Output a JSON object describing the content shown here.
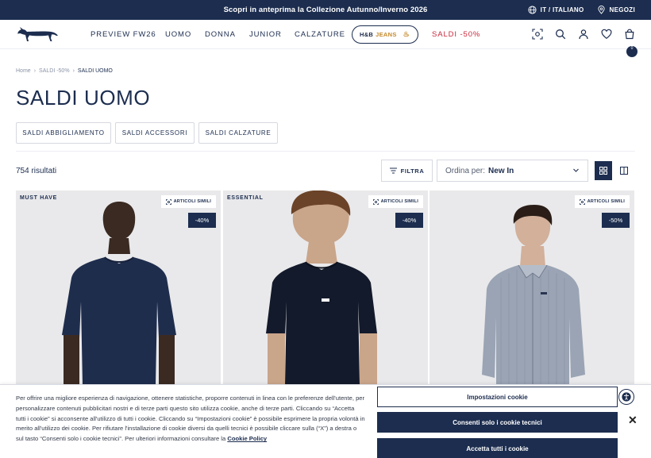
{
  "promo": {
    "text": "Scopri in anteprima la Collezione Autunno/Inverno 2026",
    "language": "IT / ITALIANO",
    "stores": "NEGOZI"
  },
  "header": {
    "nav": [
      "PREVIEW FW26",
      "UOMO",
      "DONNA",
      "JUNIOR",
      "CALZATURE"
    ],
    "jeans_hb": "H&B",
    "jeans_word": "JEANS",
    "sale": "SALDI -50%",
    "cart_count": "0"
  },
  "breadcrumb": [
    "Home",
    "SALDI -50%",
    "SALDI UOMO"
  ],
  "page_title": "SALDI UOMO",
  "categories": [
    "SALDI ABBIGLIAMENTO",
    "SALDI ACCESSORI",
    "SALDI CALZATURE"
  ],
  "toolbar": {
    "results": "754 risultati",
    "filter": "FILTRA",
    "sort_label": "Ordina per:",
    "sort_value": "New In"
  },
  "products": [
    {
      "tag": "MUST HAVE",
      "similar": "ARTICOLI SIMILI",
      "discount": "-40%",
      "garment_color": "#1f2d4d",
      "garment": "t-shirt"
    },
    {
      "tag": "ESSENTIAL",
      "similar": "ARTICOLI SIMILI",
      "discount": "-40%",
      "garment_color": "#131a2b",
      "garment": "t-shirt"
    },
    {
      "tag": "",
      "similar": "ARTICOLI SIMILI",
      "discount": "-50%",
      "garment_color": "#9aa4b4",
      "garment": "shirt"
    }
  ],
  "cookie": {
    "text": "Per offrire una migliore esperienza di navigazione, ottenere statistiche, proporre contenuti in linea con le preferenze dell'utente, per personalizzare contenuti pubblicitari nostri e di terze parti questo sito utilizza cookie, anche di terze parti. Cliccando su “Accetta tutti i cookie” si acconsente all'utilizzo di tutti i cookie. Cliccando su “Impostazioni cookie” è possibile esprimere la propria volontà in merito all'utilizzo dei cookie. Per rifiutare l'installazione di cookie diversi da quelli tecnici è possibile cliccare sulla (“X”) a destra o sul tasto “Consenti solo i cookie tecnici”. Per ulteriori informazioni consultare la",
    "policy_link": "Cookie Policy",
    "settings": "Impostazioni cookie",
    "technical_only": "Consenti solo i cookie tecnici",
    "accept_all": "Accetta tutti i cookie",
    "close": "✕"
  },
  "colors": {
    "brand_navy": "#1c2d4f",
    "sale_red": "#c8283c",
    "jeans_gold": "#c58a2c"
  }
}
